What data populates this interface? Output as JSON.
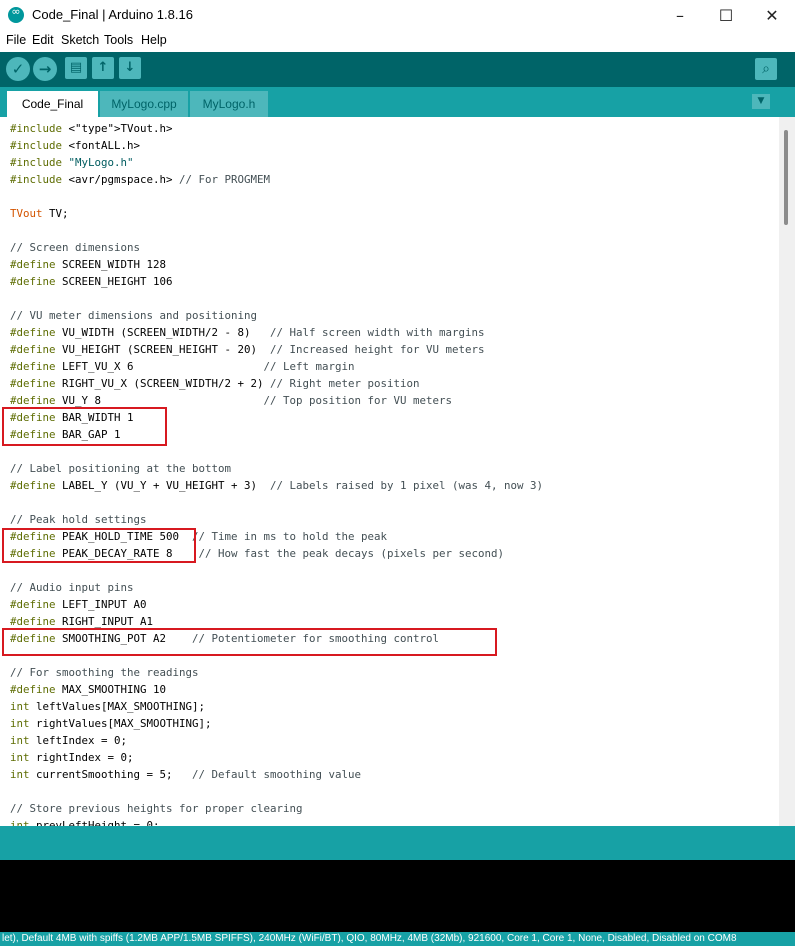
{
  "window": {
    "title": "Code_Final | Arduino 1.8.16",
    "controls": [
      "–",
      "☐",
      "✕"
    ]
  },
  "menu": [
    "File",
    "Edit",
    "Sketch",
    "Tools",
    "Help"
  ],
  "toolbar": {
    "verify_icon": "✓",
    "upload_icon": "→",
    "new_icon": "▤",
    "open_icon": "↑",
    "save_icon": "↓",
    "serial_icon": "⌕"
  },
  "tabs": [
    {
      "label": "Code_Final",
      "active": true
    },
    {
      "label": "MyLogo.cpp",
      "active": false
    },
    {
      "label": "MyLogo.h",
      "active": false
    }
  ],
  "tab_menu_icon": "▼",
  "code_lines": [
    "#include <TVout.h>",
    "#include <fontALL.h>",
    "#include \"MyLogo.h\"",
    "#include <avr/pgmspace.h> // For PROGMEM",
    "",
    "TVout TV;",
    "",
    "// Screen dimensions",
    "#define SCREEN_WIDTH 128",
    "#define SCREEN_HEIGHT 106",
    "",
    "// VU meter dimensions and positioning",
    "#define VU_WIDTH (SCREEN_WIDTH/2 - 8)   // Half screen width with margins",
    "#define VU_HEIGHT (SCREEN_HEIGHT - 20)  // Increased height for VU meters",
    "#define LEFT_VU_X 6                    // Left margin",
    "#define RIGHT_VU_X (SCREEN_WIDTH/2 + 2) // Right meter position",
    "#define VU_Y 8                         // Top position for VU meters",
    "#define BAR_WIDTH 1",
    "#define BAR_GAP 1",
    "",
    "// Label positioning at the bottom",
    "#define LABEL_Y (VU_Y + VU_HEIGHT + 3)  // Labels raised by 1 pixel (was 4, now 3)",
    "",
    "// Peak hold settings",
    "#define PEAK_HOLD_TIME 500  // Time in ms to hold the peak",
    "#define PEAK_DECAY_RATE 8    // How fast the peak decays (pixels per second)",
    "",
    "// Audio input pins",
    "#define LEFT_INPUT A0",
    "#define RIGHT_INPUT A1",
    "#define SMOOTHING_POT A2    // Potentiometer for smoothing control",
    "",
    "// For smoothing the readings",
    "#define MAX_SMOOTHING 10",
    "int leftValues[MAX_SMOOTHING];",
    "int rightValues[MAX_SMOOTHING];",
    "int leftIndex = 0;",
    "int rightIndex = 0;",
    "int currentSmoothing = 5;   // Default smoothing value",
    "",
    "// Store previous heights for proper clearing",
    "int prevLeftHeight = 0;"
  ],
  "colors": {
    "toolbar_bg": "#006468",
    "tabs_bg": "#17a1a5",
    "button_fill": "#4db7bb",
    "keyword": "#5e6d03",
    "string": "#005c5f",
    "type": "#d35400",
    "comment": "#434f54",
    "highlight_box": "#d71920",
    "console_bg": "#000000"
  },
  "status_text": "let), Default 4MB with spiffs (1.2MB APP/1.5MB SPIFFS), 240MHz (WiFi/BT), QIO, 80MHz, 4MB (32Mb), 921600, Core 1, Core 1, None, Disabled, Disabled on COM8"
}
